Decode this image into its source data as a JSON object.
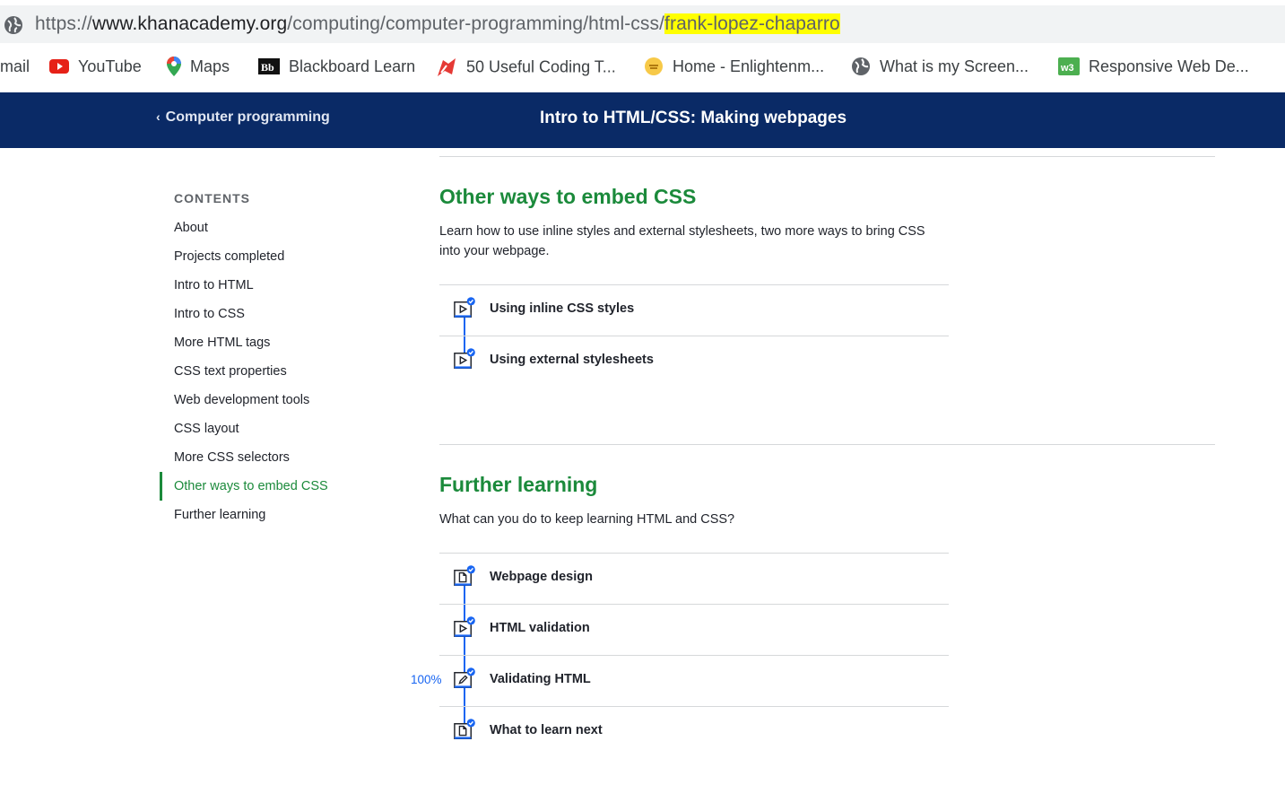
{
  "browser": {
    "url_scheme": "https://",
    "url_domain": "www.khanacademy.org",
    "url_path": "/computing/computer-programming/html-css/",
    "url_highlight": "frank-lopez-chaparro",
    "bookmarks": [
      {
        "label": "mail",
        "icon": "gmail-icon"
      },
      {
        "label": "YouTube",
        "icon": "youtube-icon"
      },
      {
        "label": "Maps",
        "icon": "maps-icon"
      },
      {
        "label": "Blackboard Learn",
        "icon": "blackboard-icon"
      },
      {
        "label": "50 Useful Coding T...",
        "icon": "coding-tips-icon"
      },
      {
        "label": "Home - Enlightenm...",
        "icon": "enlightenment-icon"
      },
      {
        "label": "What is my Screen...",
        "icon": "globe-icon"
      },
      {
        "label": "Responsive Web De...",
        "icon": "w3-icon"
      }
    ]
  },
  "header": {
    "back_label": "Computer programming",
    "title": "Intro to HTML/CSS: Making webpages"
  },
  "sidebar": {
    "heading": "CONTENTS",
    "items": [
      "About",
      "Projects completed",
      "Intro to HTML",
      "Intro to CSS",
      "More HTML tags",
      "CSS text properties",
      "Web development tools",
      "CSS layout",
      "More CSS selectors",
      "Other ways to embed CSS",
      "Further learning"
    ],
    "active_index": 9
  },
  "sections": [
    {
      "title": "Other ways to embed CSS",
      "description": "Learn how to use inline styles and external stylesheets, two more ways to bring CSS into your webpage.",
      "items": [
        {
          "label": "Using inline CSS styles",
          "icon": "video-icon",
          "completed": true
        },
        {
          "label": "Using external stylesheets",
          "icon": "video-icon",
          "completed": true
        }
      ]
    },
    {
      "title": "Further learning",
      "description": "What can you do to keep learning HTML and CSS?",
      "items": [
        {
          "label": "Webpage design",
          "icon": "article-icon",
          "completed": true
        },
        {
          "label": "HTML validation",
          "icon": "video-icon",
          "completed": true
        },
        {
          "label": "Validating HTML",
          "icon": "exercise-icon",
          "completed": true,
          "progress": "100%"
        },
        {
          "label": "What to learn next",
          "icon": "article-icon",
          "completed": true
        }
      ]
    }
  ],
  "colors": {
    "nav_bg": "#0a2a66",
    "accent_green": "#1b8a3b",
    "progress_blue": "#1865f2"
  }
}
